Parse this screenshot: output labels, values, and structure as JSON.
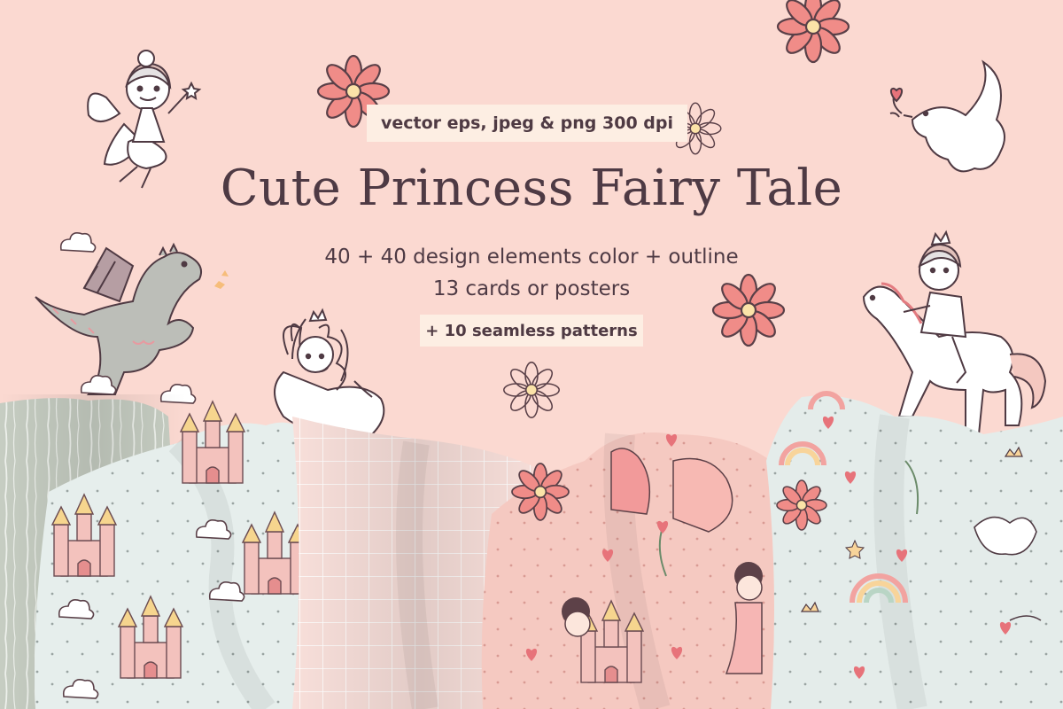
{
  "header": {
    "format_badge": "vector eps, jpeg & png 300 dpi",
    "title": "Cute Princess Fairy Tale",
    "line_elements": "40 + 40 design elements color + outline",
    "line_cards": "13 cards or posters",
    "patterns_badge": "+ 10 seamless patterns"
  },
  "colors": {
    "background": "#fbd9d1",
    "badge": "#fdeee3",
    "text": "#4e3a44",
    "flower": "#f08c88",
    "sage_fabric": "#c4cbc0",
    "mint_fabric": "#e4ecea",
    "pink_fabric": "#f7dcd7",
    "blush_fabric": "#f4c8c0",
    "dragon": "#b9bbb5"
  },
  "illustrations": {
    "flowers": [
      "flower-icon",
      "flower-icon",
      "flower-icon",
      "flower-icon",
      "flower-icon",
      "flower-icon"
    ],
    "characters": [
      "fairy-illustration",
      "dragon-illustration",
      "princess-illustration",
      "prince-on-horse-illustration",
      "dove-illustration"
    ],
    "fabrics": [
      "sage-striped-fabric",
      "mint-castle-fabric",
      "pink-grid-fabric",
      "blush-characters-fabric",
      "mint-rainbow-fabric"
    ]
  }
}
